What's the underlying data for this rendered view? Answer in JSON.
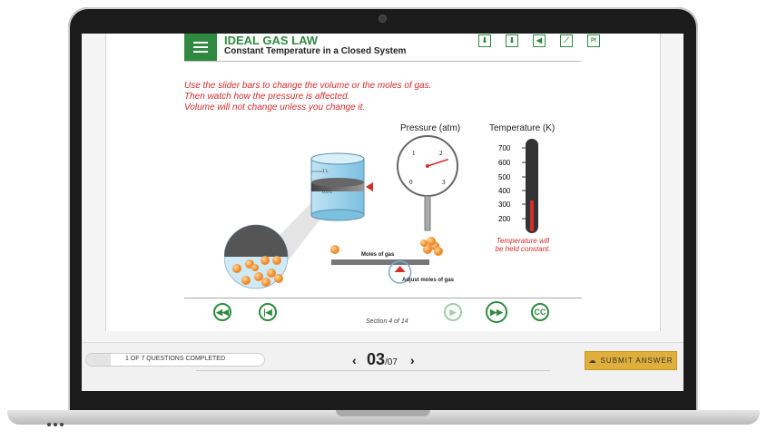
{
  "simulation": {
    "title": "IDEAL GAS LAW",
    "subtitle": "Constant Temperature in a Closed System",
    "toolbar_icons": [
      "download-icon",
      "download-icon",
      "audio-icon",
      "graph-icon",
      "periodic-table-icon"
    ],
    "periodic_label": "Pt",
    "instructions": [
      "Use the slider bars to change the volume or the moles of gas.",
      "Then watch how the pressure is affected.",
      "Volume will not change unless you change it."
    ],
    "cylinder": {
      "mark_1": "1 L",
      "mark_2": "0.5 L"
    },
    "pressure": {
      "label": "Pressure (atm)",
      "ticks": [
        "0",
        "1",
        "2",
        "3"
      ],
      "reading": 2.3
    },
    "temperature": {
      "label": "Temperature (K)",
      "ticks": [
        "700",
        "600",
        "500",
        "400",
        "300",
        "200"
      ],
      "note_1": "Temperature will",
      "note_2": "be held constant."
    },
    "moles": {
      "label": "Moles of gas",
      "adjust_label": "Adjust moles of gas",
      "level": 0.7
    },
    "nav": {
      "rewind": "rewind",
      "back": "back",
      "play": "play",
      "fast_forward": "fast-forward",
      "cc": "CC"
    },
    "section_text": "Section 4 of 14"
  },
  "footer": {
    "progress_text": "1 OF 7 QUESTIONS COMPLETED",
    "progress_fraction": 0.14,
    "question_current": "03",
    "question_total": "/07",
    "submit_label": "SUBMIT ANSWER"
  }
}
